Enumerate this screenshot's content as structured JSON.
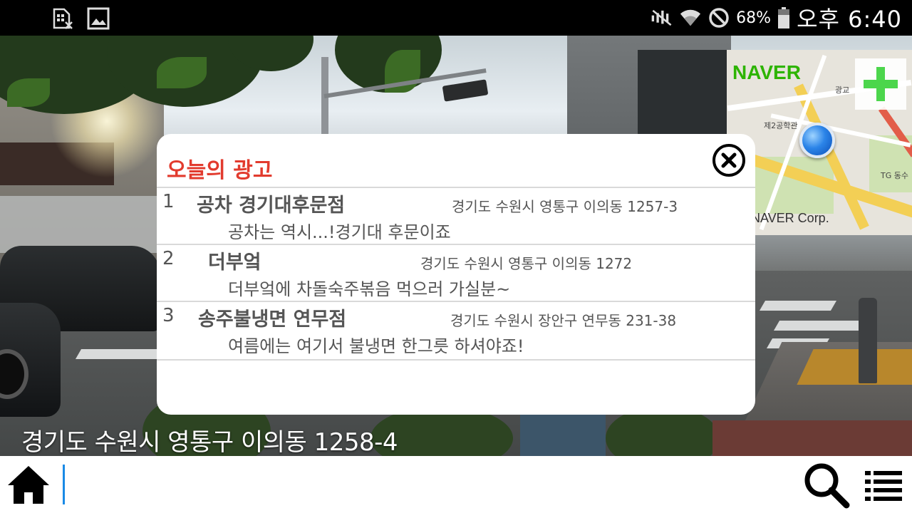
{
  "status_bar": {
    "left_icons": [
      "no-sim-icon",
      "gallery-icon"
    ],
    "right_icons": [
      "mute-icon",
      "wifi-icon",
      "blocked-icon",
      "battery-icon"
    ],
    "battery_percent": "68%",
    "time": "오후 6:40"
  },
  "map": {
    "logo": "NAVER",
    "copyright": "NAVER Corp.",
    "labels": [
      "광교",
      "제2공학관",
      "TG 동수"
    ],
    "zoom_icon": "plus-icon"
  },
  "ad_dialog": {
    "title": "오늘의 광고",
    "close_icon": "close-circle-icon",
    "items": [
      {
        "number": "1",
        "name": "공차 경기대후문점",
        "address": "경기도 수원시 영통구 이의동 1257-3",
        "description": "공차는 역시...!경기대 후문이죠"
      },
      {
        "number": "2",
        "name": "더부엌",
        "address": "경기도 수원시 영통구 이의동 1272",
        "description": "더부엌에 차돌숙주볶음 먹으러 가실분~"
      },
      {
        "number": "3",
        "name": "송주불냉면 연무점",
        "address": "경기도 수원시 장안구 연무동 231-38",
        "description": "여름에는 여기서 불냉면 한그릇 하셔야죠!"
      }
    ]
  },
  "current_address": "경기도 수원시 영통구 이의동 1258-4",
  "bottom_bar": {
    "search_value": "",
    "icons": [
      "home-icon",
      "search-icon",
      "menu-icon"
    ]
  },
  "colors": {
    "title_red": "#e23b2e",
    "naver_green": "#2db400",
    "cursor_blue": "#1a8ae6"
  }
}
